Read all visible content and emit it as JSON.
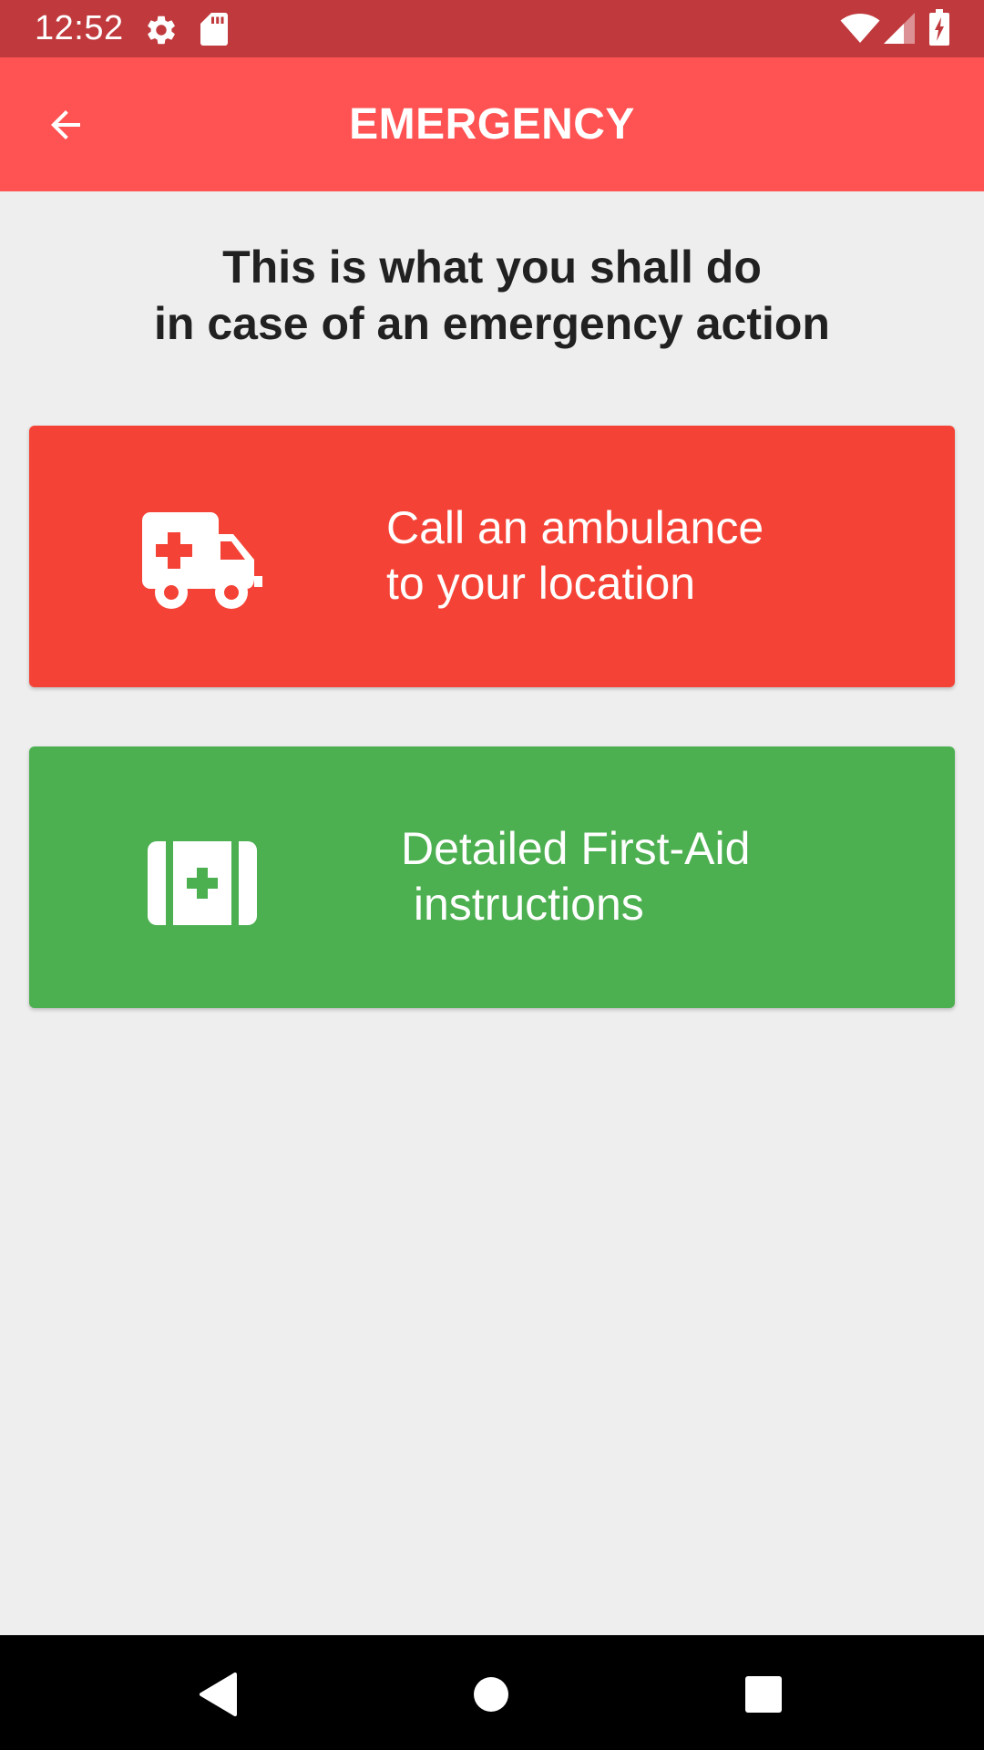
{
  "status_bar": {
    "time": "12:52",
    "icons": [
      "gear-icon",
      "sd-card-icon",
      "wifi-icon",
      "cell-signal-icon",
      "battery-charging-icon"
    ]
  },
  "app_bar": {
    "back_icon": "arrow-back-icon",
    "title": "EMERGENCY",
    "color": "#FF5252"
  },
  "heading": {
    "text": "This is what you shall do\nin case of an emergency action"
  },
  "actions": [
    {
      "icon": "ambulance-icon",
      "label": "Call an ambulance\nto your location",
      "color": "#F44336"
    },
    {
      "icon": "first-aid-kit-icon",
      "label": "Detailed First-Aid\n instructions",
      "color": "#4CAF50"
    }
  ],
  "nav_bar": {
    "buttons": [
      "back-triangle-icon",
      "home-circle-icon",
      "recents-square-icon"
    ]
  }
}
